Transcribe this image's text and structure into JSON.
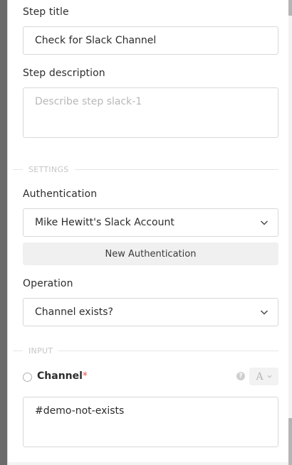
{
  "step_title": {
    "label": "Step title",
    "value": "Check for Slack Channel"
  },
  "step_description": {
    "label": "Step description",
    "placeholder": "Describe step slack-1"
  },
  "sections": {
    "settings": "SETTINGS",
    "input": "INPUT"
  },
  "authentication": {
    "label": "Authentication",
    "selected": "Mike Hewitt's Slack Account",
    "new_button": "New Authentication"
  },
  "operation": {
    "label": "Operation",
    "selected": "Channel exists?"
  },
  "channel": {
    "label": "Channel",
    "required_mark": "*",
    "value": "#demo-not-exists",
    "type_toggle": "A",
    "help_icon": "?"
  }
}
